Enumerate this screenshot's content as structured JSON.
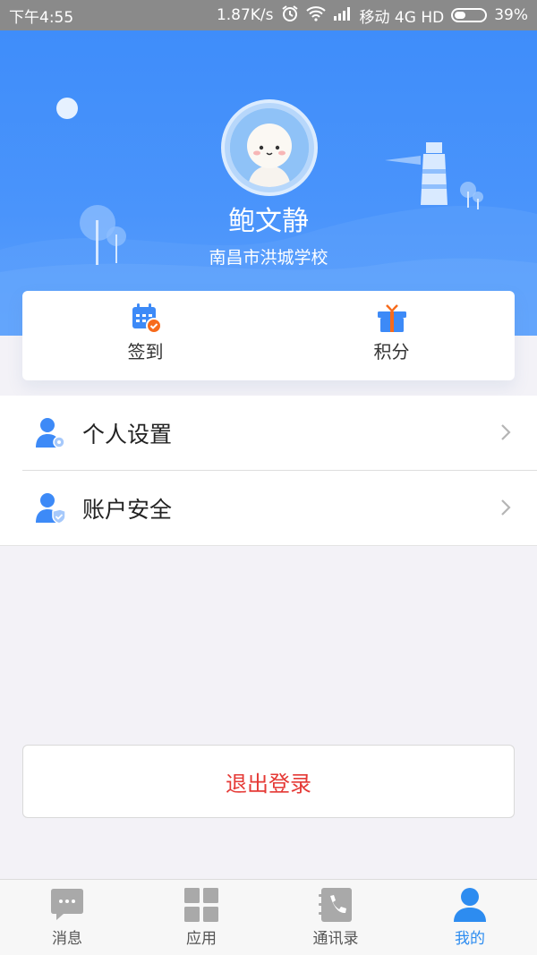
{
  "status_bar": {
    "time": "下午4:55",
    "speed": "1.87K/s",
    "carrier": "移动 4G HD",
    "battery": "39%"
  },
  "profile": {
    "name": "鲍文静",
    "school": "南昌市洪城学校"
  },
  "quick_actions": [
    {
      "label": "签到",
      "icon": "calendar-check-icon"
    },
    {
      "label": "积分",
      "icon": "gift-icon"
    }
  ],
  "menu": [
    {
      "label": "个人设置",
      "icon": "user-settings-icon"
    },
    {
      "label": "账户安全",
      "icon": "user-shield-icon"
    }
  ],
  "logout_label": "退出登录",
  "tabs": [
    {
      "label": "消息",
      "icon": "message-icon",
      "active": false
    },
    {
      "label": "应用",
      "icon": "grid-icon",
      "active": false
    },
    {
      "label": "通讯录",
      "icon": "phone-book-icon",
      "active": false
    },
    {
      "label": "我的",
      "icon": "person-icon",
      "active": true
    }
  ],
  "colors": {
    "header_blue": "#4a94fb",
    "accent": "#2d8cf0",
    "logout_red": "#e53935",
    "badge_orange": "#f76b1c"
  }
}
